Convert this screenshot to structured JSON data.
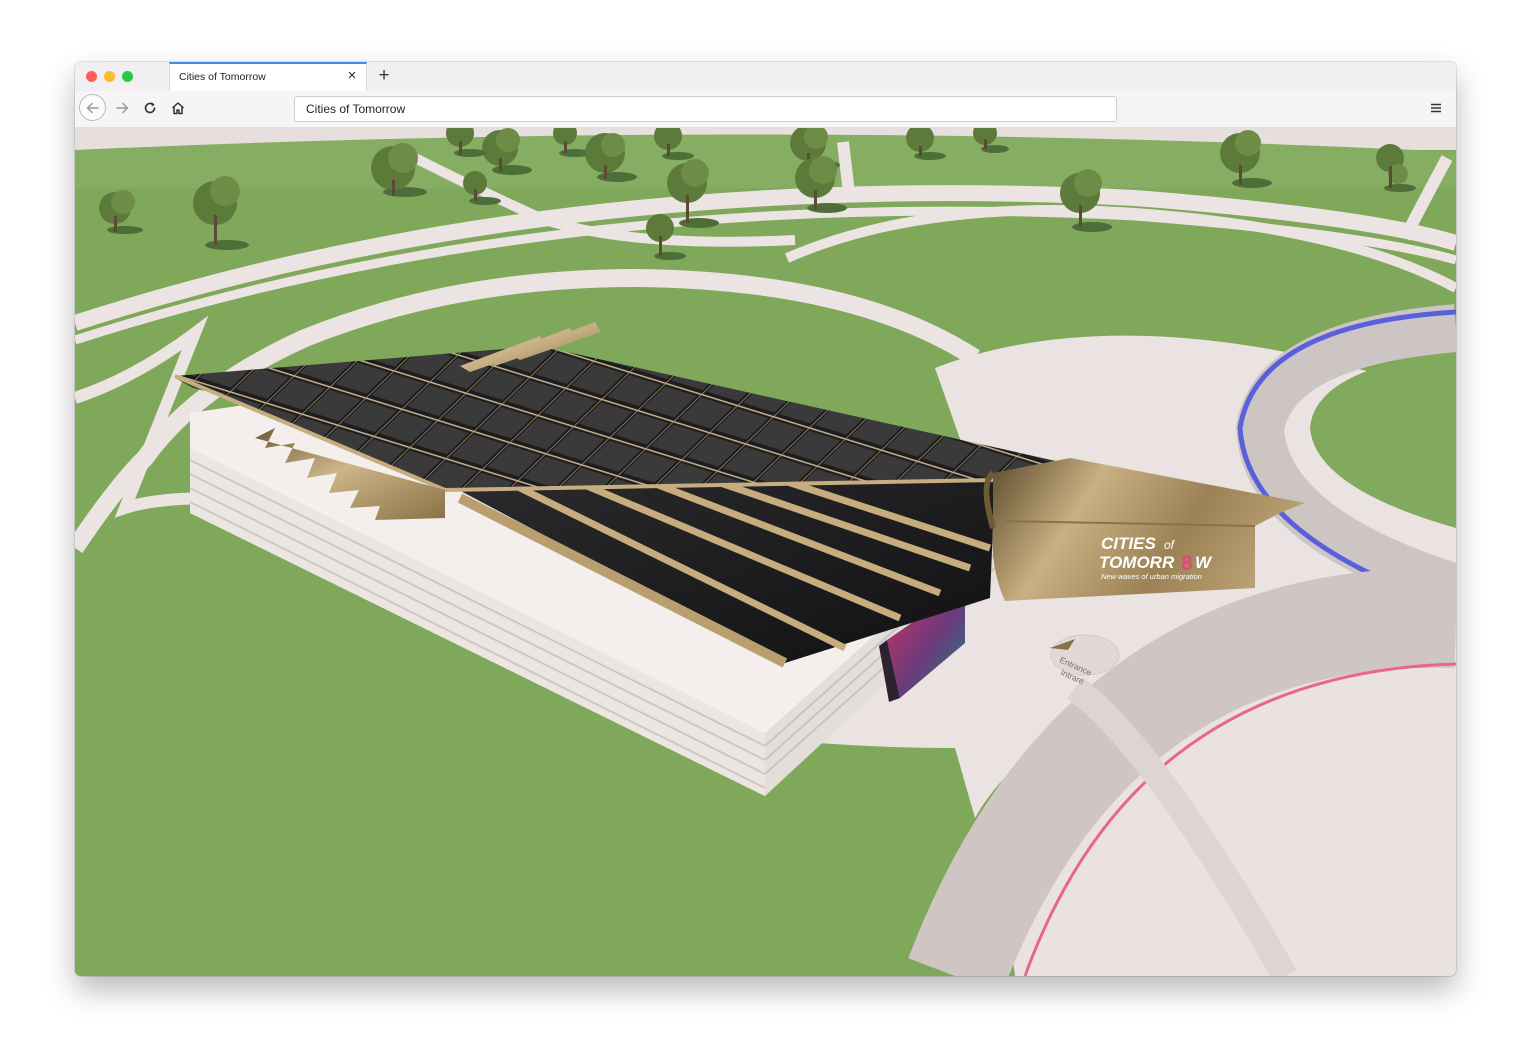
{
  "browser": {
    "tab_title": "Cities of Tomorrow",
    "new_tab_label": "+",
    "close_label": "×",
    "url": "Cities of Tomorrow",
    "icons": [
      "back-arrow-icon",
      "forward-arrow-icon",
      "reload-icon",
      "home-icon",
      "hamburger-menu-icon",
      "close-icon",
      "plus-icon"
    ]
  },
  "scene": {
    "sign_line1": "CITIES",
    "sign_of": "of",
    "sign_line2_a": "TOMORR",
    "sign_line2_b": "8",
    "sign_line2_c": "W",
    "sign_tagline": "New waves of urban migration",
    "entrance_line1": "Entrance",
    "entrance_line2": "Intrare",
    "colors": {
      "grass": "#7fa85b",
      "path": "#ebe4e2",
      "gold": "#b59b6a",
      "blue_ring": "#5a5fdc",
      "pink_ring": "#e8668a"
    }
  }
}
